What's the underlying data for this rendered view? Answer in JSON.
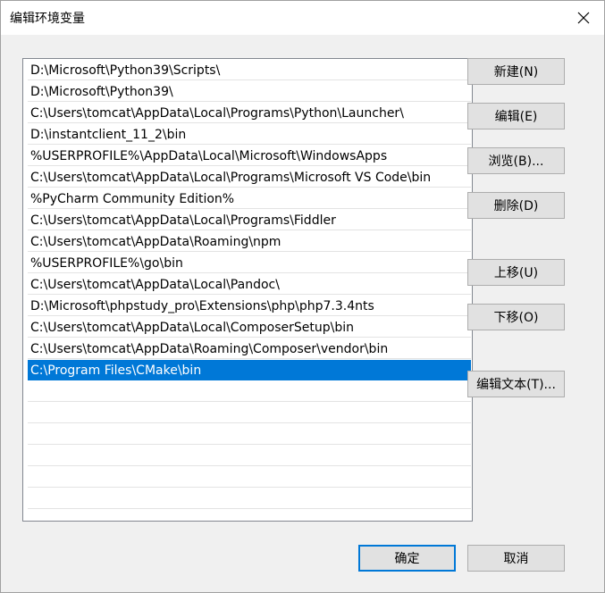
{
  "title": "编辑环境变量",
  "paths": [
    "D:\\Microsoft\\Python39\\Scripts\\",
    "D:\\Microsoft\\Python39\\",
    "C:\\Users\\tomcat\\AppData\\Local\\Programs\\Python\\Launcher\\",
    "D:\\instantclient_11_2\\bin",
    "%USERPROFILE%\\AppData\\Local\\Microsoft\\WindowsApps",
    "C:\\Users\\tomcat\\AppData\\Local\\Programs\\Microsoft VS Code\\bin",
    "%PyCharm Community Edition%",
    "C:\\Users\\tomcat\\AppData\\Local\\Programs\\Fiddler",
    "C:\\Users\\tomcat\\AppData\\Roaming\\npm",
    "%USERPROFILE%\\go\\bin",
    "C:\\Users\\tomcat\\AppData\\Local\\Pandoc\\",
    "D:\\Microsoft\\phpstudy_pro\\Extensions\\php\\php7.3.4nts",
    "C:\\Users\\tomcat\\AppData\\Local\\ComposerSetup\\bin",
    "C:\\Users\\tomcat\\AppData\\Roaming\\Composer\\vendor\\bin",
    "C:\\Program Files\\CMake\\bin"
  ],
  "selected_index": 14,
  "buttons": {
    "new": "新建(N)",
    "edit": "编辑(E)",
    "browse": "浏览(B)...",
    "delete": "删除(D)",
    "move_up": "上移(U)",
    "move_down": "下移(O)",
    "edit_text": "编辑文本(T)...",
    "ok": "确定",
    "cancel": "取消"
  },
  "colors": {
    "selection": "#0078d7",
    "button_face": "#e1e1e1",
    "dialog_bg": "#f0f0f0"
  },
  "icons": {
    "close": "close-icon"
  }
}
